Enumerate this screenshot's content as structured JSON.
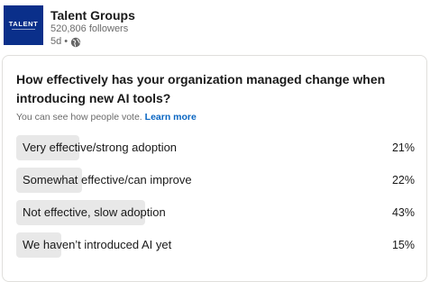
{
  "author": {
    "logo_text": "TALENT",
    "name": "Talent Groups",
    "followers": "520,806 followers",
    "time": "5d",
    "separator": "•",
    "visibility_icon": "globe-icon"
  },
  "poll": {
    "question": "How effectively has your organization managed change when introducing new AI tools?",
    "note": "You can see how people vote.",
    "learn_more": "Learn more",
    "bar_color": "#e8e8e8",
    "options": [
      {
        "label": "Very effective/strong adoption",
        "percent": "21%",
        "fill": 0.21
      },
      {
        "label": "Somewhat effective/can improve",
        "percent": "22%",
        "fill": 0.22
      },
      {
        "label": "Not effective, slow adoption",
        "percent": "43%",
        "fill": 0.43
      },
      {
        "label": "We haven’t introduced AI yet",
        "percent": "15%",
        "fill": 0.15
      }
    ]
  }
}
